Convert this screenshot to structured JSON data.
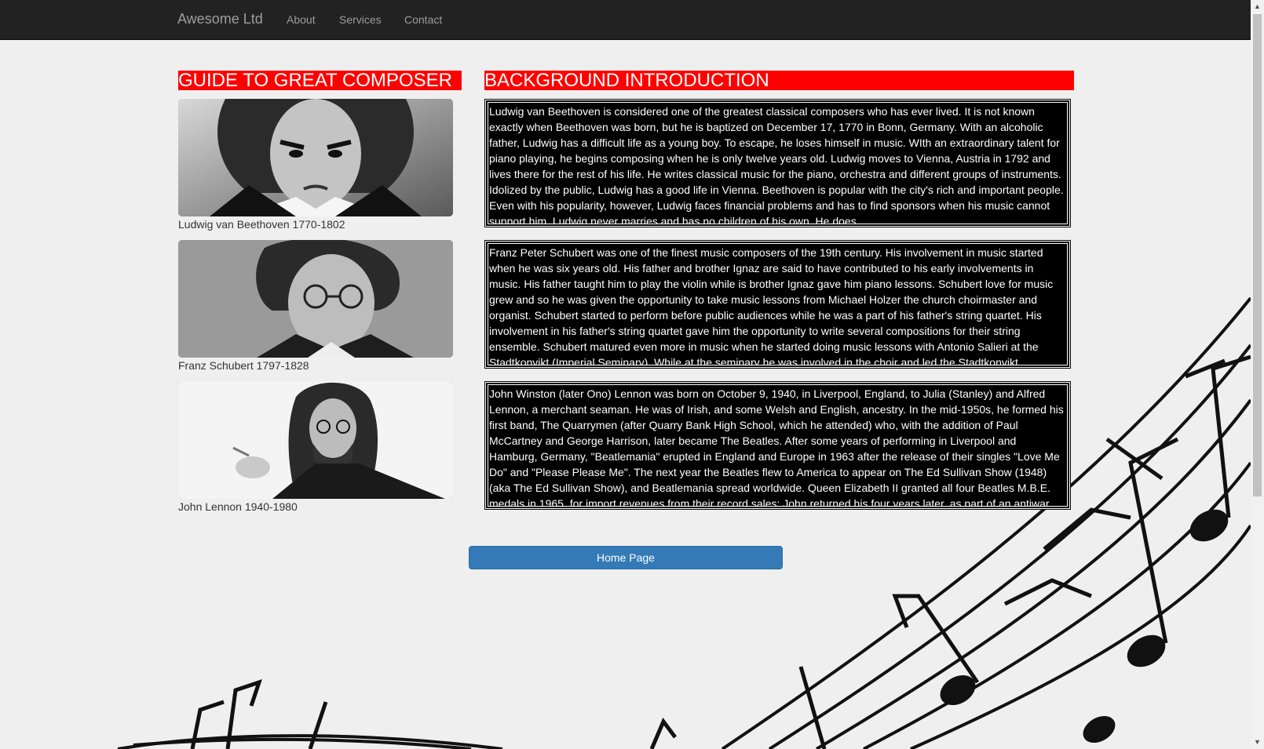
{
  "navbar": {
    "brand": "Awesome Ltd",
    "links": [
      "About",
      "Services",
      "Contact"
    ]
  },
  "headings": {
    "left": "GUIDE TO GREAT COMPOSER",
    "right": "BACKGROUND INTRODUCTION"
  },
  "composers": [
    {
      "caption": "Ludwig van Beethoven 1770-1802",
      "bio": "Ludwig van Beethoven is considered one of the greatest classical composers who has ever lived. It is not known exactly when Beethoven was born, but he is baptized on December 17, 1770 in Bonn, Germany. With an alcoholic father, Ludwig has a difficult life as a young boy. To escape, he loses himself in music. WIth an extraordinary talent for piano playing, he begins composing when he is only twelve years old. Ludwig moves to Vienna, Austria in 1792 and lives there for the rest of his life. He writes classical music for the piano, orchestra and different groups of instruments. Idolized by the public, Ludwig has a good life in Vienna. Beethoven is popular with the city's rich and important people. Even with his popularity, however, Ludwig faces financial problems and has to find sponsors when his music cannot support him. Ludwig never marries and has no children of his own. He does......."
    },
    {
      "caption": "Franz Schubert 1797-1828",
      "bio": "Franz Peter Schubert was one of the finest music composers of the 19th century. His involvement in music started when he was six years old. His father and brother Ignaz are said to have contributed to his early involvements in music. His father taught him to play the violin while is brother Ignaz gave him piano lessons. Schubert love for music grew and so he was given the opportunity to take music lessons from Michael Holzer the church choirmaster and organist. Schubert started to perform before public audiences while he was a part of his father's string quartet. His involvement in his father's string quartet gave him the opportunity to write several compositions for their string ensemble. Schubert matured even more in music when he started doing music lessons with Antonio Salieri at the Stadtkonvikt (Imperial Seminary). While at the seminary he was involved in the choir and led the Stadtkonvikt....."
    },
    {
      "caption": "John Lennon 1940-1980",
      "bio": "John Winston (later Ono) Lennon was born on October 9, 1940, in Liverpool, England, to Julia (Stanley) and Alfred Lennon, a merchant seaman. He was of Irish, and some Welsh and English, ancestry. In the mid-1950s, he formed his first band, The Quarrymen (after Quarry Bank High School, which he attended) who, with the addition of Paul McCartney and George Harrison, later became The Beatles. After some years of performing in Liverpool and Hamburg, Germany, \"Beatlemania\" erupted in England and Europe in 1963 after the release of their singles \"Love Me Do\" and \"Please Please Me\". The next year the Beatles flew to America to appear on The Ed Sullivan Show (1948) (aka The Ed Sullivan Show), and Beatlemania spread worldwide. Queen Elizabeth II granted all four Beatles M.B.E. medals in 1965, for import revenues from their record sales; John returned his four years later, as part of an antiwar statement....."
    }
  ],
  "button": {
    "label": "Home Page"
  },
  "colors": {
    "navbar": "#222222",
    "heading_bg": "#ff0000",
    "bio_bg": "#000000",
    "button": "#337ab7",
    "page_bg": "#efefef"
  }
}
